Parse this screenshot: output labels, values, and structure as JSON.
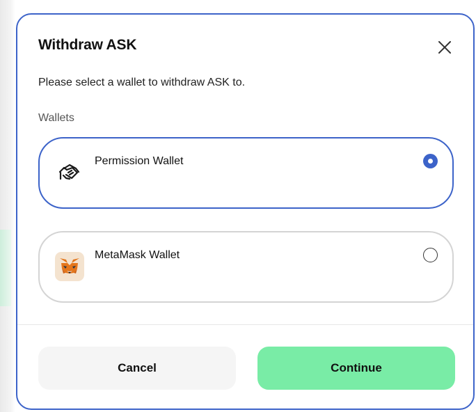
{
  "modal": {
    "title": "Withdraw ASK",
    "close_icon": "close-icon",
    "subtitle": "Please select a wallet to withdraw ASK to.",
    "section_label": "Wallets"
  },
  "wallets": [
    {
      "name": "Permission Wallet",
      "icon": "handshake-icon",
      "selected": true
    },
    {
      "name": "MetaMask Wallet",
      "icon": "metamask-fox-icon",
      "selected": false
    }
  ],
  "actions": {
    "cancel_label": "Cancel",
    "continue_label": "Continue"
  },
  "colors": {
    "accent": "#3c63c9",
    "continue_bg": "#79eca6",
    "cancel_bg": "#f5f5f5"
  }
}
